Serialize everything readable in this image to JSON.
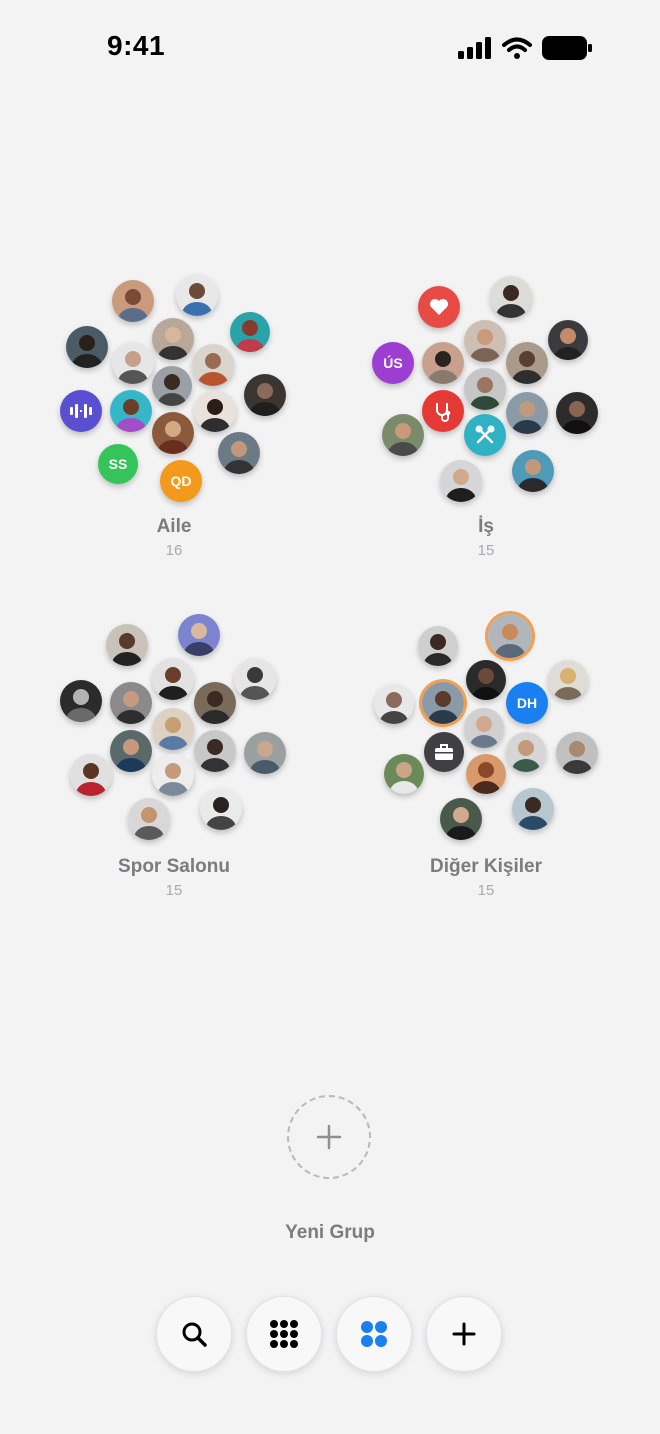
{
  "status_bar": {
    "time": "9:41"
  },
  "groups": [
    {
      "name": "Aile",
      "count": "16"
    },
    {
      "name": "İş",
      "count": "15"
    },
    {
      "name": "Spor Salonu",
      "count": "15"
    },
    {
      "name": "Diğer Kişiler",
      "count": "15"
    }
  ],
  "initials": {
    "ss": "SS",
    "qd": "QD",
    "us": "ÚS",
    "dh": "DH"
  },
  "new_group": {
    "label": "Yeni Grup"
  },
  "tab_bar": {
    "items": [
      "search-icon",
      "grid-dots-icon",
      "groups-icon",
      "plus-icon"
    ],
    "active": "groups-icon"
  },
  "colors": {
    "accent_blue": "#1a7ff0",
    "ring_orange": "#f0a050",
    "ss_green": "#34c459",
    "qd_orange": "#f39a1c",
    "us_purple": "#9b3ed1",
    "dh_blue": "#1a7ff0",
    "heart_red": "#e84b45",
    "music_purple": "#5b4fd1",
    "stethoscope_red": "#e53935",
    "tools_teal": "#2fb3c4",
    "briefcase_gray": "#3f3f44"
  }
}
